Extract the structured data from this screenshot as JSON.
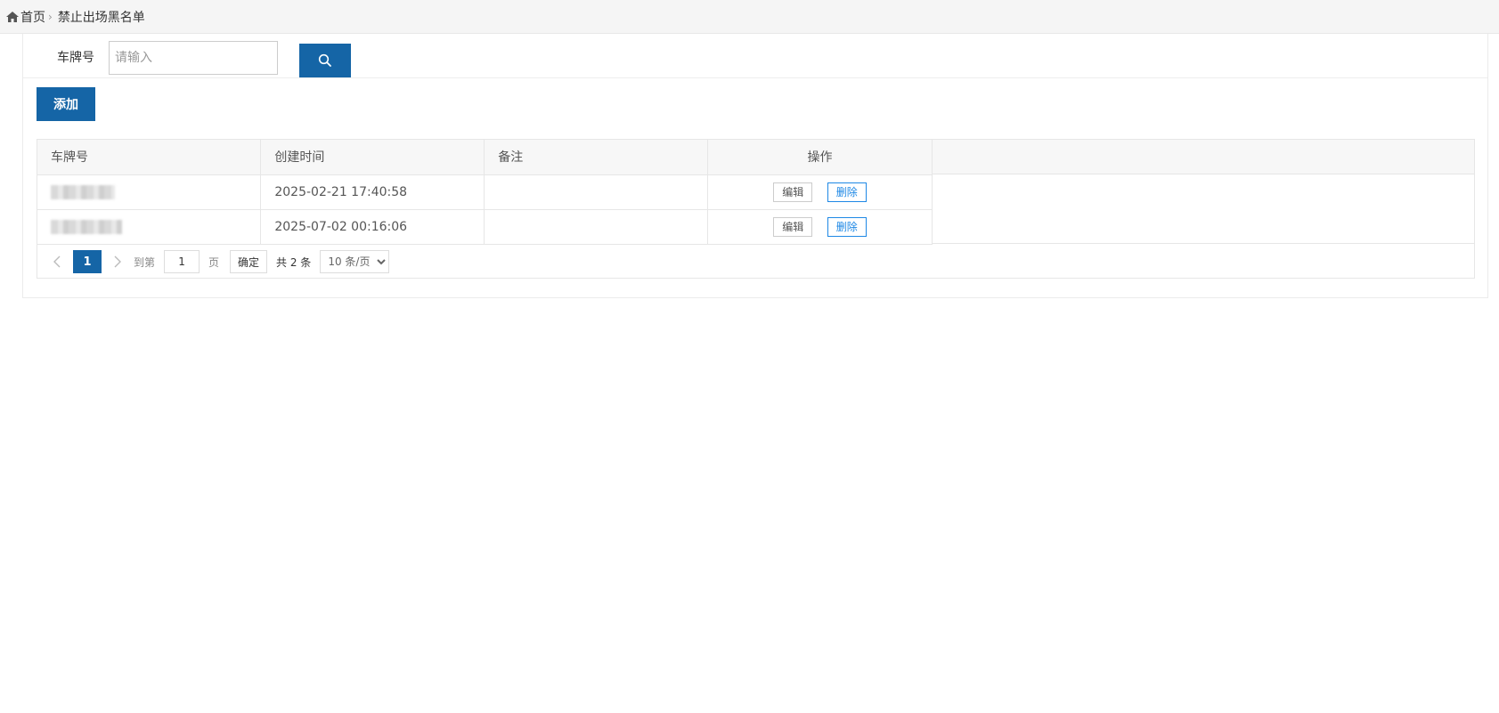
{
  "breadcrumb": {
    "home_label": "首页",
    "current_label": "禁止出场黑名单",
    "separator": "›"
  },
  "search": {
    "label": "车牌号",
    "placeholder": "请输入",
    "value": ""
  },
  "toolbar": {
    "add_label": "添加"
  },
  "table": {
    "columns": [
      "车牌号",
      "创建时间",
      "备注",
      "操作"
    ],
    "rows": [
      {
        "plate": "",
        "created": "2025-02-21 17:40:58",
        "remark": "",
        "edit_label": "编辑",
        "delete_label": "删除"
      },
      {
        "plate": "",
        "created": "2025-07-02 00:16:06",
        "remark": "",
        "edit_label": "编辑",
        "delete_label": "删除"
      }
    ]
  },
  "pagination": {
    "current_page": "1",
    "goto_label": "到第",
    "goto_value": "1",
    "page_unit": "页",
    "confirm_label": "确定",
    "total_text": "共 2 条",
    "page_size": "10 条/页"
  },
  "colors": {
    "primary": "#1565a6",
    "delete_accent": "#1e88e5"
  }
}
